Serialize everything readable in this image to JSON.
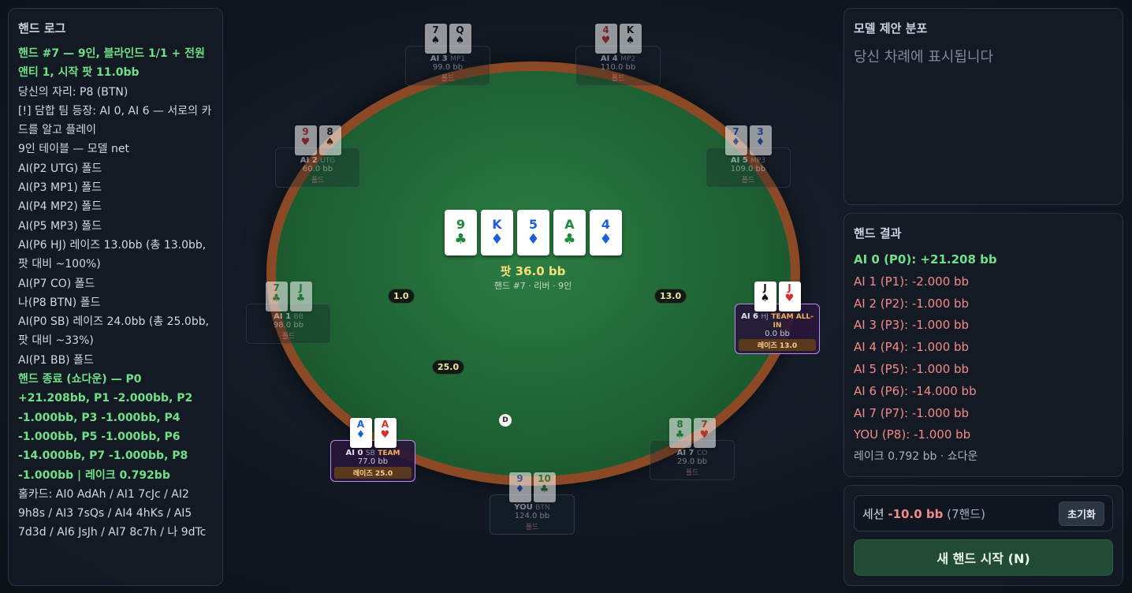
{
  "log": {
    "title": "핸드 로그",
    "lines": [
      {
        "text": "핸드 #7 — 9인, 블라인드 1/1 + 전원 앤티 1, 시작 팟 11.0bb",
        "green": true
      },
      {
        "text": "당신의 자리: P8 (BTN)",
        "green": false
      },
      {
        "text": "[!] 담합 팀 등장: AI 0, AI 6 — 서로의 카드를 알고 플레이",
        "green": false
      },
      {
        "text": "9인 테이블 — 모델 net",
        "green": false
      },
      {
        "text": "AI(P2 UTG) 폴드",
        "green": false
      },
      {
        "text": "AI(P3 MP1) 폴드",
        "green": false
      },
      {
        "text": "AI(P4 MP2) 폴드",
        "green": false
      },
      {
        "text": "AI(P5 MP3) 폴드",
        "green": false
      },
      {
        "text": "AI(P6 HJ) 레이즈 13.0bb (총 13.0bb, 팟 대비 ~100%)",
        "green": false
      },
      {
        "text": "AI(P7 CO) 폴드",
        "green": false
      },
      {
        "text": "나(P8 BTN) 폴드",
        "green": false
      },
      {
        "text": "AI(P0 SB) 레이즈 24.0bb (총 25.0bb, 팟 대비 ~33%)",
        "green": false
      },
      {
        "text": "AI(P1 BB) 폴드",
        "green": false
      },
      {
        "text": "핸드 종료 (쇼다운) — P0 +21.208bb, P1 -2.000bb, P2 -1.000bb, P3 -1.000bb, P4 -1.000bb, P5 -1.000bb, P6 -14.000bb, P7 -1.000bb, P8 -1.000bb | 레이크 0.792bb",
        "green": true
      },
      {
        "text": "홀카드: AI0 AdAh / AI1 7cJc / AI2 9h8s / AI3 7sQs / AI4 4hKs / AI5 7d3d / AI6 JsJh / AI7 8c7h / 나 9dTc",
        "green": false
      }
    ]
  },
  "distribution": {
    "title": "모델 제안 분포",
    "placeholder": "당신 차례에 표시됩니다"
  },
  "result": {
    "title": "핸드 결과",
    "lines": [
      {
        "text": "AI 0 (P0): +21.208 bb",
        "kind": "win"
      },
      {
        "text": "AI 1 (P1): -2.000 bb",
        "kind": "loss"
      },
      {
        "text": "AI 2 (P2): -1.000 bb",
        "kind": "loss"
      },
      {
        "text": "AI 3 (P3): -1.000 bb",
        "kind": "loss"
      },
      {
        "text": "AI 4 (P4): -1.000 bb",
        "kind": "loss"
      },
      {
        "text": "AI 5 (P5): -1.000 bb",
        "kind": "loss"
      },
      {
        "text": "AI 6 (P6): -14.000 bb",
        "kind": "loss"
      },
      {
        "text": "AI 7 (P7): -1.000 bb",
        "kind": "loss"
      },
      {
        "text": "YOU (P8): -1.000 bb",
        "kind": "loss"
      },
      {
        "text": "레이크 0.792 bb · 쇼다운",
        "kind": "muted"
      }
    ]
  },
  "session": {
    "label": "세션",
    "amount": "-10.0 bb",
    "count": "(7핸드)",
    "reset_label": "초기화",
    "new_hand_label": "새 핸드 시작 (N)"
  },
  "board": {
    "cards": [
      {
        "rank": "9",
        "suit": "♣",
        "color": "green-s"
      },
      {
        "rank": "K",
        "suit": "♦",
        "color": "blue"
      },
      {
        "rank": "5",
        "suit": "♦",
        "color": "blue"
      },
      {
        "rank": "A",
        "suit": "♣",
        "color": "green-s"
      },
      {
        "rank": "4",
        "suit": "♦",
        "color": "blue"
      }
    ],
    "pot": "팟 36.0 bb",
    "sub": "핸드 #7 · 리버 · 9인"
  },
  "seats": {
    "ai3": {
      "name": "AI 3",
      "pos": "MP1",
      "stack": "99.0 bb",
      "status": "폴드",
      "cards": [
        {
          "rank": "7",
          "suit": "♠",
          "color": "black"
        },
        {
          "rank": "Q",
          "suit": "♠",
          "color": "black"
        }
      ]
    },
    "ai4": {
      "name": "AI 4",
      "pos": "MP2",
      "stack": "110.0 bb",
      "status": "폴드",
      "cards": [
        {
          "rank": "4",
          "suit": "♥",
          "color": "red"
        },
        {
          "rank": "K",
          "suit": "♠",
          "color": "black"
        }
      ]
    },
    "ai2": {
      "name": "AI 2",
      "pos": "UTG",
      "stack": "60.0 bb",
      "status": "폴드",
      "cards": [
        {
          "rank": "9",
          "suit": "♥",
          "color": "red"
        },
        {
          "rank": "8",
          "suit": "♠",
          "color": "black"
        }
      ]
    },
    "ai5": {
      "name": "AI 5",
      "pos": "MP3",
      "stack": "109.0 bb",
      "status": "폴드",
      "cards": [
        {
          "rank": "7",
          "suit": "♦",
          "color": "blue"
        },
        {
          "rank": "3",
          "suit": "♦",
          "color": "blue"
        }
      ]
    },
    "ai1": {
      "name": "AI 1",
      "pos": "BB",
      "stack": "98.0 bb",
      "status": "폴드",
      "cards": [
        {
          "rank": "7",
          "suit": "♣",
          "color": "green-s"
        },
        {
          "rank": "J",
          "suit": "♣",
          "color": "green-s"
        }
      ]
    },
    "ai6": {
      "name": "AI 6",
      "pos": "HJ",
      "team": "TEAM ALL-IN",
      "stack": "0.0 bb",
      "status": "레이즈 13.0",
      "cards": [
        {
          "rank": "J",
          "suit": "♠",
          "color": "black"
        },
        {
          "rank": "J",
          "suit": "♥",
          "color": "red"
        }
      ]
    },
    "ai0": {
      "name": "AI 0",
      "pos": "SB",
      "team": "TEAM",
      "stack": "77.0 bb",
      "status": "레이즈 25.0",
      "cards": [
        {
          "rank": "A",
          "suit": "♦",
          "color": "blue"
        },
        {
          "rank": "A",
          "suit": "♥",
          "color": "red"
        }
      ]
    },
    "ai7": {
      "name": "AI 7",
      "pos": "CO",
      "stack": "29.0 bb",
      "status": "폴드",
      "cards": [
        {
          "rank": "8",
          "suit": "♣",
          "color": "green-s"
        },
        {
          "rank": "7",
          "suit": "♥",
          "color": "red"
        }
      ]
    },
    "you": {
      "name": "YOU",
      "pos": "BTN",
      "stack": "124.0 bb",
      "status": "폴드",
      "cards": [
        {
          "rank": "9",
          "suit": "♦",
          "color": "blue"
        },
        {
          "rank": "10",
          "suit": "♣",
          "color": "green-s"
        }
      ]
    }
  },
  "bets": {
    "ai1": "1.0",
    "ai6": "13.0",
    "ai0": "25.0"
  },
  "dealer_label": "D"
}
